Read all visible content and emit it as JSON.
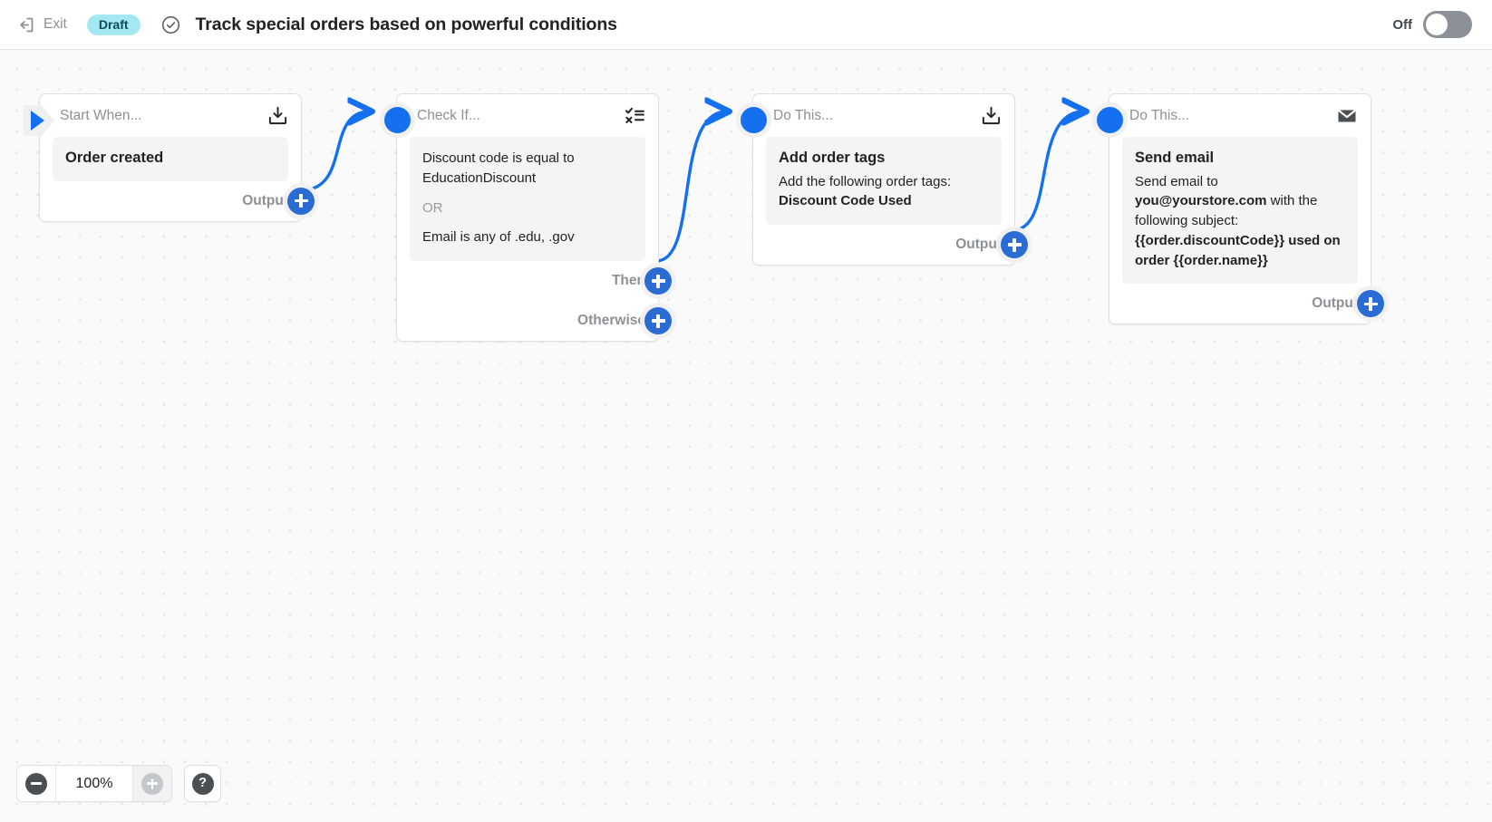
{
  "header": {
    "exit_label": "Exit",
    "exit_icon": "exit-arrow-icon",
    "status_badge": "Draft",
    "check_icon": "check-circle-icon",
    "title": "Track special orders based on powerful conditions",
    "toggle_label": "Off",
    "toggle_state": "off"
  },
  "canvas": {
    "nodes": [
      {
        "id": "trigger",
        "header_title": "Start When...",
        "header_icon": "download-box-icon",
        "marker_icon": "play-triangle-icon",
        "body_title": "Order created",
        "ports": [
          {
            "label": "Output",
            "button_icon": "plus-icon"
          }
        ]
      },
      {
        "id": "condition",
        "header_title": "Check If...",
        "header_icon": "checklist-icon",
        "marker_icon": "input-dot-icon",
        "conditions": [
          {
            "type": "condition",
            "text": "Discount code is equal to EducationDiscount"
          },
          {
            "type": "operator",
            "text": "OR"
          },
          {
            "type": "condition",
            "text": "Email is any of .edu, .gov"
          }
        ],
        "ports": [
          {
            "label": "Then",
            "button_icon": "plus-icon"
          },
          {
            "label": "Otherwise",
            "button_icon": "plus-icon"
          }
        ]
      },
      {
        "id": "action-tags",
        "header_title": "Do This...",
        "header_icon": "download-box-icon",
        "marker_icon": "input-dot-icon",
        "body_title": "Add order tags",
        "body_line_1": "Add the following order tags:",
        "body_line_2_bold": "Discount Code Used",
        "ports": [
          {
            "label": "Output",
            "button_icon": "plus-icon"
          }
        ]
      },
      {
        "id": "action-email",
        "header_title": "Do This...",
        "header_icon": "envelope-icon",
        "marker_icon": "input-dot-icon",
        "body_title": "Send email",
        "email_prefix": "Send email to ",
        "email_address": "you@yourstore.com",
        "email_middle": " with the following subject: ",
        "email_subject": "{{order.discountCode}} used on order {{order.name}}",
        "ports": [
          {
            "label": "Output",
            "button_icon": "plus-icon"
          }
        ]
      }
    ]
  },
  "zoom_controls": {
    "zoom_out_icon": "minus-circle-icon",
    "zoom_level": "100%",
    "zoom_in_icon": "plus-circle-icon",
    "help_label": "?",
    "help_icon": "question-mark-icon"
  },
  "colors": {
    "accent_blue": "#1570ef",
    "port_blue": "#2b6cd4",
    "draft_badge_bg": "#a4e8f2",
    "canvas_bg": "#fafafa",
    "node_body_bg": "#f4f4f4",
    "muted_text": "#8c9196"
  }
}
